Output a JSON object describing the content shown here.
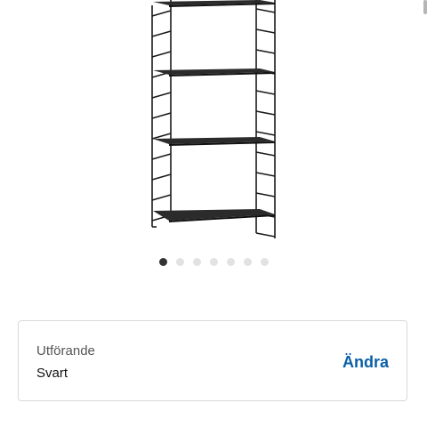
{
  "product": {
    "image_icon": "wall-shelf-ladder-image",
    "carousel": {
      "dot_count": 7,
      "active_index": 0
    }
  },
  "variant": {
    "label": "Utförande",
    "value": "Svart",
    "change_label": "Ändra"
  },
  "colors": {
    "accent": "#0a5fa7",
    "active_dot": "#333333",
    "inactive_dot": "#e2e2e2",
    "card_border": "#d9d9d9"
  }
}
